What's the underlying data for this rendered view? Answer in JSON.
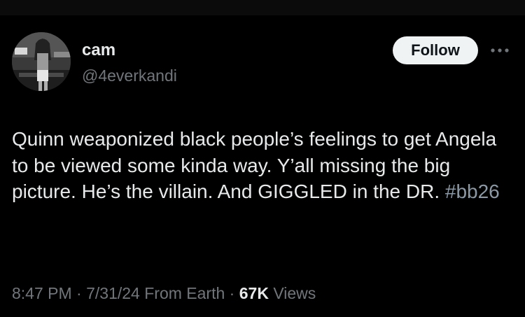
{
  "author": {
    "display_name": "cam",
    "handle": "@4everkandi"
  },
  "actions": {
    "follow_label": "Follow",
    "more_icon": "more-horizontal-icon"
  },
  "tweet": {
    "text": "Quinn weaponized black people’s feelings to get Angela to be viewed some kinda way. Y’all missing the big picture. He’s the villain. And GIGGLED in the DR.",
    "hashtag": "#bb26"
  },
  "meta": {
    "time": "8:47 PM",
    "separator": "·",
    "date": "7/31/24",
    "source": "From Earth",
    "views_count": "67K",
    "views_label": "Views"
  },
  "colors": {
    "background": "#000000",
    "text_primary": "#e7e9ea",
    "text_secondary": "#71767b",
    "hashtag": "#8b98a5",
    "button_bg": "#eff3f4"
  }
}
